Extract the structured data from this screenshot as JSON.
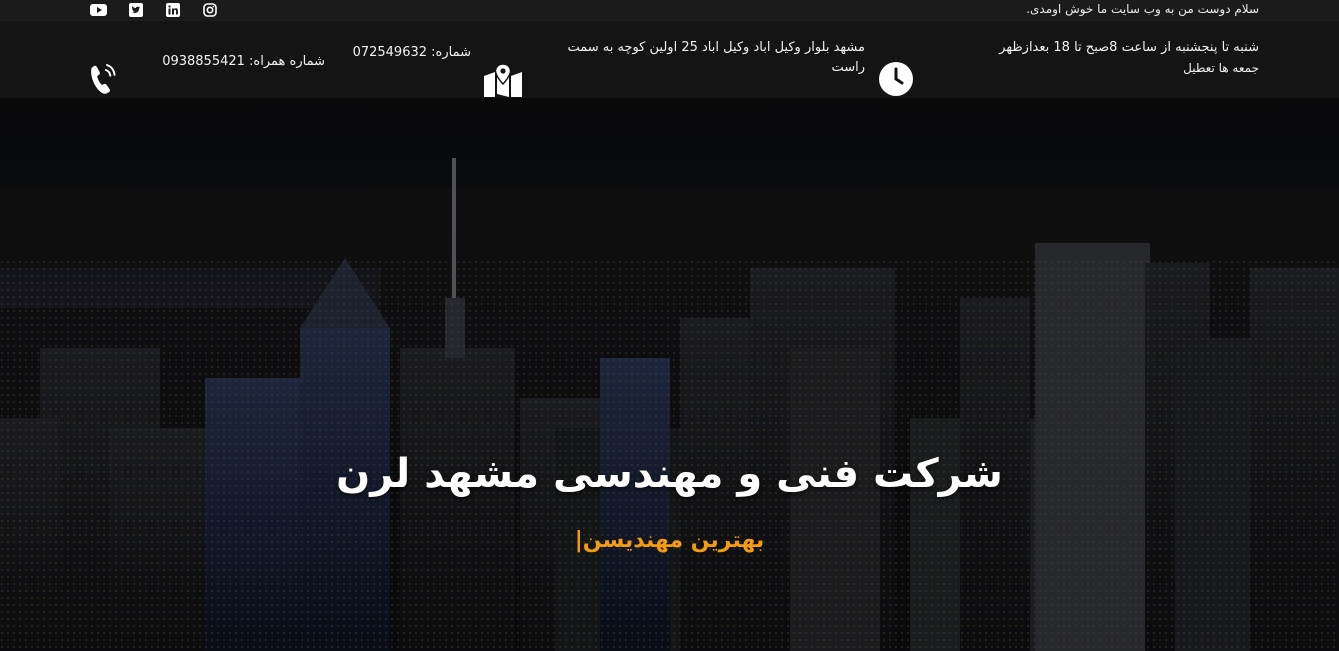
{
  "topbar": {
    "greeting": "سلام دوست من به وب سایت ما خوش اومدی.",
    "socials": [
      "youtube-icon",
      "twitter-icon",
      "linkedin-icon",
      "instagram-icon"
    ]
  },
  "info": {
    "hours_line1": "شنبه تا پنجشنبه از ساعت 8صبح تا 18 بعدازظهر",
    "hours_line2": "جمعه ها تعطیل",
    "address": "مشهد بلوار وکیل اباد وکیل اباد 25 اولین کوچه به سمت راست",
    "phone": "شماره: 072549632",
    "mobile": "شماره همراه: 0938855421"
  },
  "hero": {
    "title": "شرکت فنی و مهندسی مشهد لرن",
    "subtitle": "بهترین مهندیسن|"
  },
  "colors": {
    "accent": "#f39c12",
    "bar": "#141414",
    "topbar": "#1b1b1b"
  }
}
